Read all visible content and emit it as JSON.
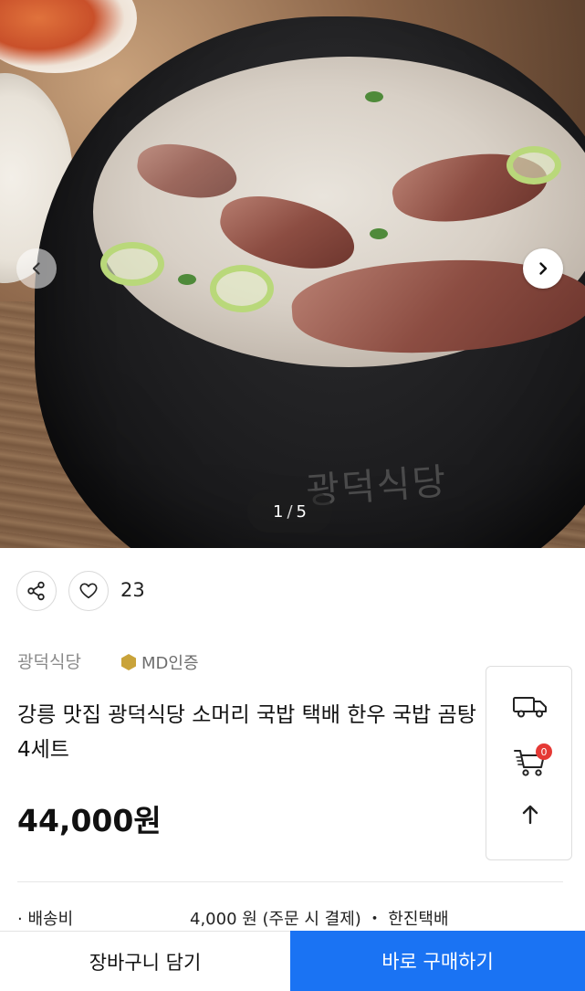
{
  "gallery": {
    "current": "1",
    "separator": "/",
    "total": "5",
    "pot_engraving": "광덕식당"
  },
  "actions": {
    "like_count": "23"
  },
  "product": {
    "seller": "광덕식당",
    "badge": "MD인증",
    "title": "강릉 맛집 광덕식당 소머리 국밥 택배 한우 국밥 곰탕 4세트",
    "price": "44,000원"
  },
  "float_panel": {
    "cart_count": "0"
  },
  "shipping": {
    "label": "배송비",
    "info": "4,000 원 (주문 시 결제) ・ 한진택배"
  },
  "bottom_bar": {
    "cart_label": "장바구니 담기",
    "buy_label": "바로 구매하기"
  },
  "colors": {
    "primary": "#1a73f3",
    "badge_red": "#e53935",
    "md_gold": "#c9a33a"
  }
}
